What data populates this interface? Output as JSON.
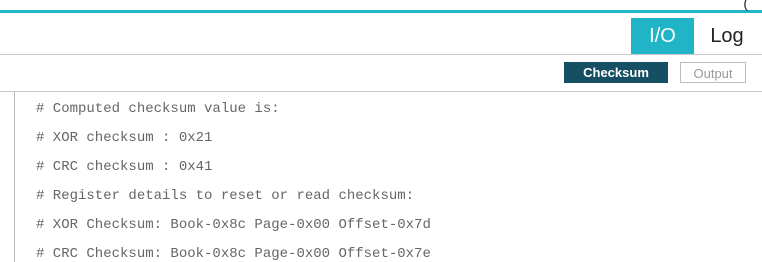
{
  "header": {
    "corner_mark": "("
  },
  "tabs": [
    {
      "label": "I/O",
      "active": true
    },
    {
      "label": "Log",
      "active": false
    }
  ],
  "toolbar": {
    "checksum_label": "Checksum",
    "output_label": "Output"
  },
  "console": {
    "lines": [
      "# Computed checksum value is:",
      "# XOR checksum : 0x21",
      "# CRC checksum : 0x41",
      "# Register details to reset or read checksum:",
      "# XOR Checksum: Book-0x8c Page-0x00 Offset-0x7d",
      "# CRC Checksum: Book-0x8c Page-0x00 Offset-0x7e"
    ]
  },
  "colors": {
    "accent": "#1fb4c6",
    "button_dark": "#164e63",
    "console_text": "#666666"
  }
}
